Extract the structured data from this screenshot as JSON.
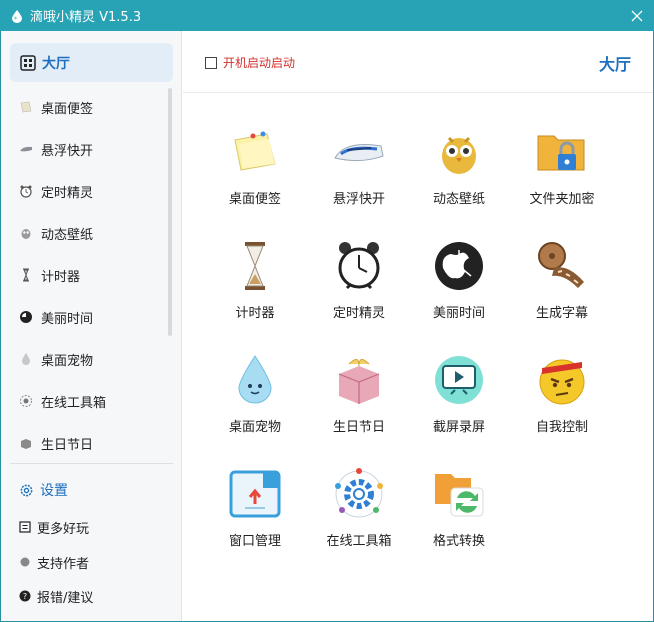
{
  "window": {
    "title": "滴哦小精灵 V1.5.3",
    "close_glyph": "✕"
  },
  "sidebar": {
    "active": {
      "label": "大厅",
      "icon": "grid-icon"
    },
    "items": [
      {
        "label": "桌面便签",
        "icon": "note-icon"
      },
      {
        "label": "悬浮快开",
        "icon": "train-icon"
      },
      {
        "label": "定时精灵",
        "icon": "alarm-icon"
      },
      {
        "label": "动态壁纸",
        "icon": "owl-icon"
      },
      {
        "label": "计时器",
        "icon": "hourglass-icon"
      },
      {
        "label": "美丽时间",
        "icon": "clock-icon"
      },
      {
        "label": "桌面宠物",
        "icon": "droplet-icon"
      },
      {
        "label": "在线工具箱",
        "icon": "gear-ring-icon"
      },
      {
        "label": "生日节日",
        "icon": "gift-icon"
      }
    ],
    "settings": {
      "label": "设置",
      "icon": "gear-icon"
    },
    "bottom": [
      {
        "label": "更多好玩",
        "icon": "menu-square-icon"
      },
      {
        "label": "支持作者",
        "icon": "dot-icon"
      },
      {
        "label": "报错/建议",
        "icon": "question-icon"
      }
    ]
  },
  "header": {
    "autostart_label": "开机启动启动",
    "autostart_checked": false,
    "page_title": "大厅"
  },
  "tiles": [
    {
      "label": "桌面便签",
      "icon": "sticky-note-icon"
    },
    {
      "label": "悬浮快开",
      "icon": "bullet-train-icon"
    },
    {
      "label": "动态壁纸",
      "icon": "owl-icon"
    },
    {
      "label": "文件夹加密",
      "icon": "locked-folder-icon"
    },
    {
      "label": "计时器",
      "icon": "hourglass-icon"
    },
    {
      "label": "定时精灵",
      "icon": "alarm-clock-icon"
    },
    {
      "label": "美丽时间",
      "icon": "apple-clock-icon"
    },
    {
      "label": "生成字幕",
      "icon": "film-reel-icon"
    },
    {
      "label": "桌面宠物",
      "icon": "water-drop-icon"
    },
    {
      "label": "生日节日",
      "icon": "gift-box-icon"
    },
    {
      "label": "截屏录屏",
      "icon": "screen-record-icon"
    },
    {
      "label": "自我控制",
      "icon": "angry-face-icon"
    },
    {
      "label": "窗口管理",
      "icon": "window-manage-icon"
    },
    {
      "label": "在线工具箱",
      "icon": "toolbox-gear-icon"
    },
    {
      "label": "格式转换",
      "icon": "format-convert-icon"
    }
  ],
  "colors": {
    "titlebar": "#27a3b5",
    "accent": "#1e6fbf",
    "autostart_text": "#d0312d",
    "active_bg": "#e3edf8"
  }
}
